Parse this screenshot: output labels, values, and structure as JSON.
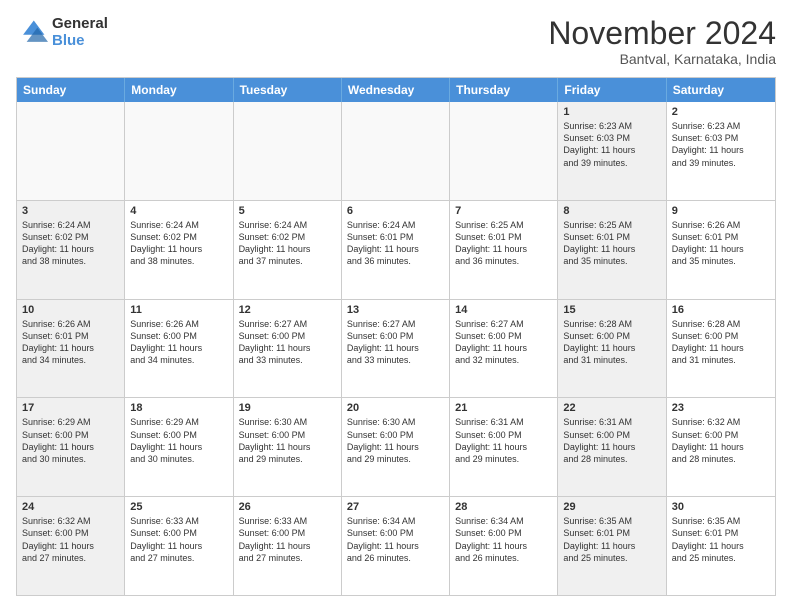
{
  "logo": {
    "general": "General",
    "blue": "Blue"
  },
  "title": "November 2024",
  "location": "Bantval, Karnataka, India",
  "header_days": [
    "Sunday",
    "Monday",
    "Tuesday",
    "Wednesday",
    "Thursday",
    "Friday",
    "Saturday"
  ],
  "weeks": [
    [
      {
        "day": "",
        "text": "",
        "empty": true
      },
      {
        "day": "",
        "text": "",
        "empty": true
      },
      {
        "day": "",
        "text": "",
        "empty": true
      },
      {
        "day": "",
        "text": "",
        "empty": true
      },
      {
        "day": "",
        "text": "",
        "empty": true
      },
      {
        "day": "1",
        "text": "Sunrise: 6:23 AM\nSunset: 6:03 PM\nDaylight: 11 hours\nand 39 minutes.",
        "shaded": true
      },
      {
        "day": "2",
        "text": "Sunrise: 6:23 AM\nSunset: 6:03 PM\nDaylight: 11 hours\nand 39 minutes.",
        "shaded": false
      }
    ],
    [
      {
        "day": "3",
        "text": "Sunrise: 6:24 AM\nSunset: 6:02 PM\nDaylight: 11 hours\nand 38 minutes.",
        "shaded": true
      },
      {
        "day": "4",
        "text": "Sunrise: 6:24 AM\nSunset: 6:02 PM\nDaylight: 11 hours\nand 38 minutes.",
        "shaded": false
      },
      {
        "day": "5",
        "text": "Sunrise: 6:24 AM\nSunset: 6:02 PM\nDaylight: 11 hours\nand 37 minutes.",
        "shaded": false
      },
      {
        "day": "6",
        "text": "Sunrise: 6:24 AM\nSunset: 6:01 PM\nDaylight: 11 hours\nand 36 minutes.",
        "shaded": false
      },
      {
        "day": "7",
        "text": "Sunrise: 6:25 AM\nSunset: 6:01 PM\nDaylight: 11 hours\nand 36 minutes.",
        "shaded": false
      },
      {
        "day": "8",
        "text": "Sunrise: 6:25 AM\nSunset: 6:01 PM\nDaylight: 11 hours\nand 35 minutes.",
        "shaded": true
      },
      {
        "day": "9",
        "text": "Sunrise: 6:26 AM\nSunset: 6:01 PM\nDaylight: 11 hours\nand 35 minutes.",
        "shaded": false
      }
    ],
    [
      {
        "day": "10",
        "text": "Sunrise: 6:26 AM\nSunset: 6:01 PM\nDaylight: 11 hours\nand 34 minutes.",
        "shaded": true
      },
      {
        "day": "11",
        "text": "Sunrise: 6:26 AM\nSunset: 6:00 PM\nDaylight: 11 hours\nand 34 minutes.",
        "shaded": false
      },
      {
        "day": "12",
        "text": "Sunrise: 6:27 AM\nSunset: 6:00 PM\nDaylight: 11 hours\nand 33 minutes.",
        "shaded": false
      },
      {
        "day": "13",
        "text": "Sunrise: 6:27 AM\nSunset: 6:00 PM\nDaylight: 11 hours\nand 33 minutes.",
        "shaded": false
      },
      {
        "day": "14",
        "text": "Sunrise: 6:27 AM\nSunset: 6:00 PM\nDaylight: 11 hours\nand 32 minutes.",
        "shaded": false
      },
      {
        "day": "15",
        "text": "Sunrise: 6:28 AM\nSunset: 6:00 PM\nDaylight: 11 hours\nand 31 minutes.",
        "shaded": true
      },
      {
        "day": "16",
        "text": "Sunrise: 6:28 AM\nSunset: 6:00 PM\nDaylight: 11 hours\nand 31 minutes.",
        "shaded": false
      }
    ],
    [
      {
        "day": "17",
        "text": "Sunrise: 6:29 AM\nSunset: 6:00 PM\nDaylight: 11 hours\nand 30 minutes.",
        "shaded": true
      },
      {
        "day": "18",
        "text": "Sunrise: 6:29 AM\nSunset: 6:00 PM\nDaylight: 11 hours\nand 30 minutes.",
        "shaded": false
      },
      {
        "day": "19",
        "text": "Sunrise: 6:30 AM\nSunset: 6:00 PM\nDaylight: 11 hours\nand 29 minutes.",
        "shaded": false
      },
      {
        "day": "20",
        "text": "Sunrise: 6:30 AM\nSunset: 6:00 PM\nDaylight: 11 hours\nand 29 minutes.",
        "shaded": false
      },
      {
        "day": "21",
        "text": "Sunrise: 6:31 AM\nSunset: 6:00 PM\nDaylight: 11 hours\nand 29 minutes.",
        "shaded": false
      },
      {
        "day": "22",
        "text": "Sunrise: 6:31 AM\nSunset: 6:00 PM\nDaylight: 11 hours\nand 28 minutes.",
        "shaded": true
      },
      {
        "day": "23",
        "text": "Sunrise: 6:32 AM\nSunset: 6:00 PM\nDaylight: 11 hours\nand 28 minutes.",
        "shaded": false
      }
    ],
    [
      {
        "day": "24",
        "text": "Sunrise: 6:32 AM\nSunset: 6:00 PM\nDaylight: 11 hours\nand 27 minutes.",
        "shaded": true
      },
      {
        "day": "25",
        "text": "Sunrise: 6:33 AM\nSunset: 6:00 PM\nDaylight: 11 hours\nand 27 minutes.",
        "shaded": false
      },
      {
        "day": "26",
        "text": "Sunrise: 6:33 AM\nSunset: 6:00 PM\nDaylight: 11 hours\nand 27 minutes.",
        "shaded": false
      },
      {
        "day": "27",
        "text": "Sunrise: 6:34 AM\nSunset: 6:00 PM\nDaylight: 11 hours\nand 26 minutes.",
        "shaded": false
      },
      {
        "day": "28",
        "text": "Sunrise: 6:34 AM\nSunset: 6:00 PM\nDaylight: 11 hours\nand 26 minutes.",
        "shaded": false
      },
      {
        "day": "29",
        "text": "Sunrise: 6:35 AM\nSunset: 6:01 PM\nDaylight: 11 hours\nand 25 minutes.",
        "shaded": true
      },
      {
        "day": "30",
        "text": "Sunrise: 6:35 AM\nSunset: 6:01 PM\nDaylight: 11 hours\nand 25 minutes.",
        "shaded": false
      }
    ]
  ]
}
